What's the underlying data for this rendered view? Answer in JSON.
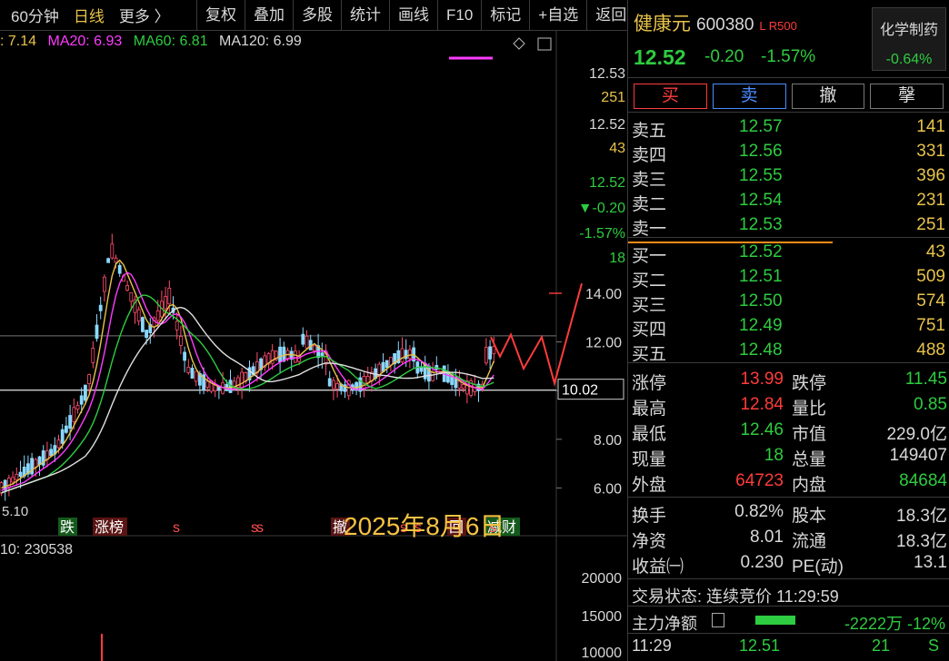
{
  "toolbar": {
    "period_60": "60分钟",
    "period_day": "日线",
    "more": "更多 〉",
    "buttons": [
      "复权",
      "叠加",
      "多股",
      "统计",
      "画线",
      "F10",
      "标记",
      "+自选",
      "返回"
    ]
  },
  "ma": {
    "ma5": ": 7.14",
    "ma20": "MA20: 6.93",
    "ma60": "MA60: 6.81",
    "ma120": "MA120: 6.99"
  },
  "price_axis": {
    "top_labels": [
      "12.53",
      "251",
      "12.52",
      "43",
      "12.52",
      "▼-0.20",
      "-1.57%",
      "18"
    ],
    "ticks": [
      "14.00",
      "12.00",
      "10.00",
      "8.00",
      "6.00"
    ],
    "current_price_tag": "10.02",
    "low_label": "5.10"
  },
  "events": [
    "跌",
    "涨榜",
    "s",
    "s",
    "s",
    "撤",
    "s",
    "s",
    "回",
    "减财",
    "s"
  ],
  "volume": {
    "header": "10: 230538",
    "ticks": [
      "20000",
      "15000",
      "10000"
    ]
  },
  "annotation": "2025年8月6日",
  "stock": {
    "name": "健康元",
    "code": "600380",
    "flag": "L R500",
    "price": "12.52",
    "change": "-0.20",
    "change_pct": "-1.57%",
    "sector": "化学制药",
    "sector_pct": "-0.64%"
  },
  "trade_buttons": [
    "买",
    "卖",
    "撤",
    "撀"
  ],
  "asks": [
    {
      "label": "卖五",
      "price": "12.57",
      "vol": "141"
    },
    {
      "label": "卖四",
      "price": "12.56",
      "vol": "331"
    },
    {
      "label": "卖三",
      "price": "12.55",
      "vol": "396"
    },
    {
      "label": "卖二",
      "price": "12.54",
      "vol": "231"
    },
    {
      "label": "卖一",
      "price": "12.53",
      "vol": "251"
    }
  ],
  "bids": [
    {
      "label": "买一",
      "price": "12.52",
      "vol": "43"
    },
    {
      "label": "买二",
      "price": "12.51",
      "vol": "509"
    },
    {
      "label": "买三",
      "price": "12.50",
      "vol": "574"
    },
    {
      "label": "买四",
      "price": "12.49",
      "vol": "751"
    },
    {
      "label": "买五",
      "price": "12.48",
      "vol": "488"
    }
  ],
  "stats1": [
    {
      "k1": "涨停",
      "v1": "13.99",
      "c1": "red",
      "k2": "跌停",
      "v2": "11.45",
      "c2": "green"
    },
    {
      "k1": "最高",
      "v1": "12.84",
      "c1": "red",
      "k2": "量比",
      "v2": "0.85",
      "c2": "green"
    },
    {
      "k1": "最低",
      "v1": "12.46",
      "c1": "green",
      "k2": "市值",
      "v2": "229.0亿",
      "c2": ""
    },
    {
      "k1": "现量",
      "v1": "18",
      "c1": "green",
      "k2": "总量",
      "v2": "149407",
      "c2": ""
    },
    {
      "k1": "外盘",
      "v1": "64723",
      "c1": "red",
      "k2": "内盘",
      "v2": "84684",
      "c2": "green"
    }
  ],
  "stats2": [
    {
      "k1": "换手",
      "v1": "0.82%",
      "c1": "",
      "k2": "股本",
      "v2": "18.3亿",
      "c2": ""
    },
    {
      "k1": "净资",
      "v1": "8.01",
      "c1": "",
      "k2": "流通",
      "v2": "18.3亿",
      "c2": ""
    },
    {
      "k1": "收益㈠",
      "v1": "0.230",
      "c1": "",
      "k2": "PE(动)",
      "v2": "13.1",
      "c2": ""
    }
  ],
  "trade_state": "交易状态: 连续竞价 11:29:59",
  "net_flow": {
    "label": "主力净额",
    "value": "-2222万 -12%"
  },
  "tick": {
    "time": "11:29",
    "price": "12.51",
    "vol": "21",
    "dir": "S"
  },
  "colors": {
    "up": "#ff3b3b",
    "down": "#2ecc40",
    "accent": "#e8c34a",
    "ma20": "#ff3bff",
    "ma60": "#2ecc40"
  }
}
